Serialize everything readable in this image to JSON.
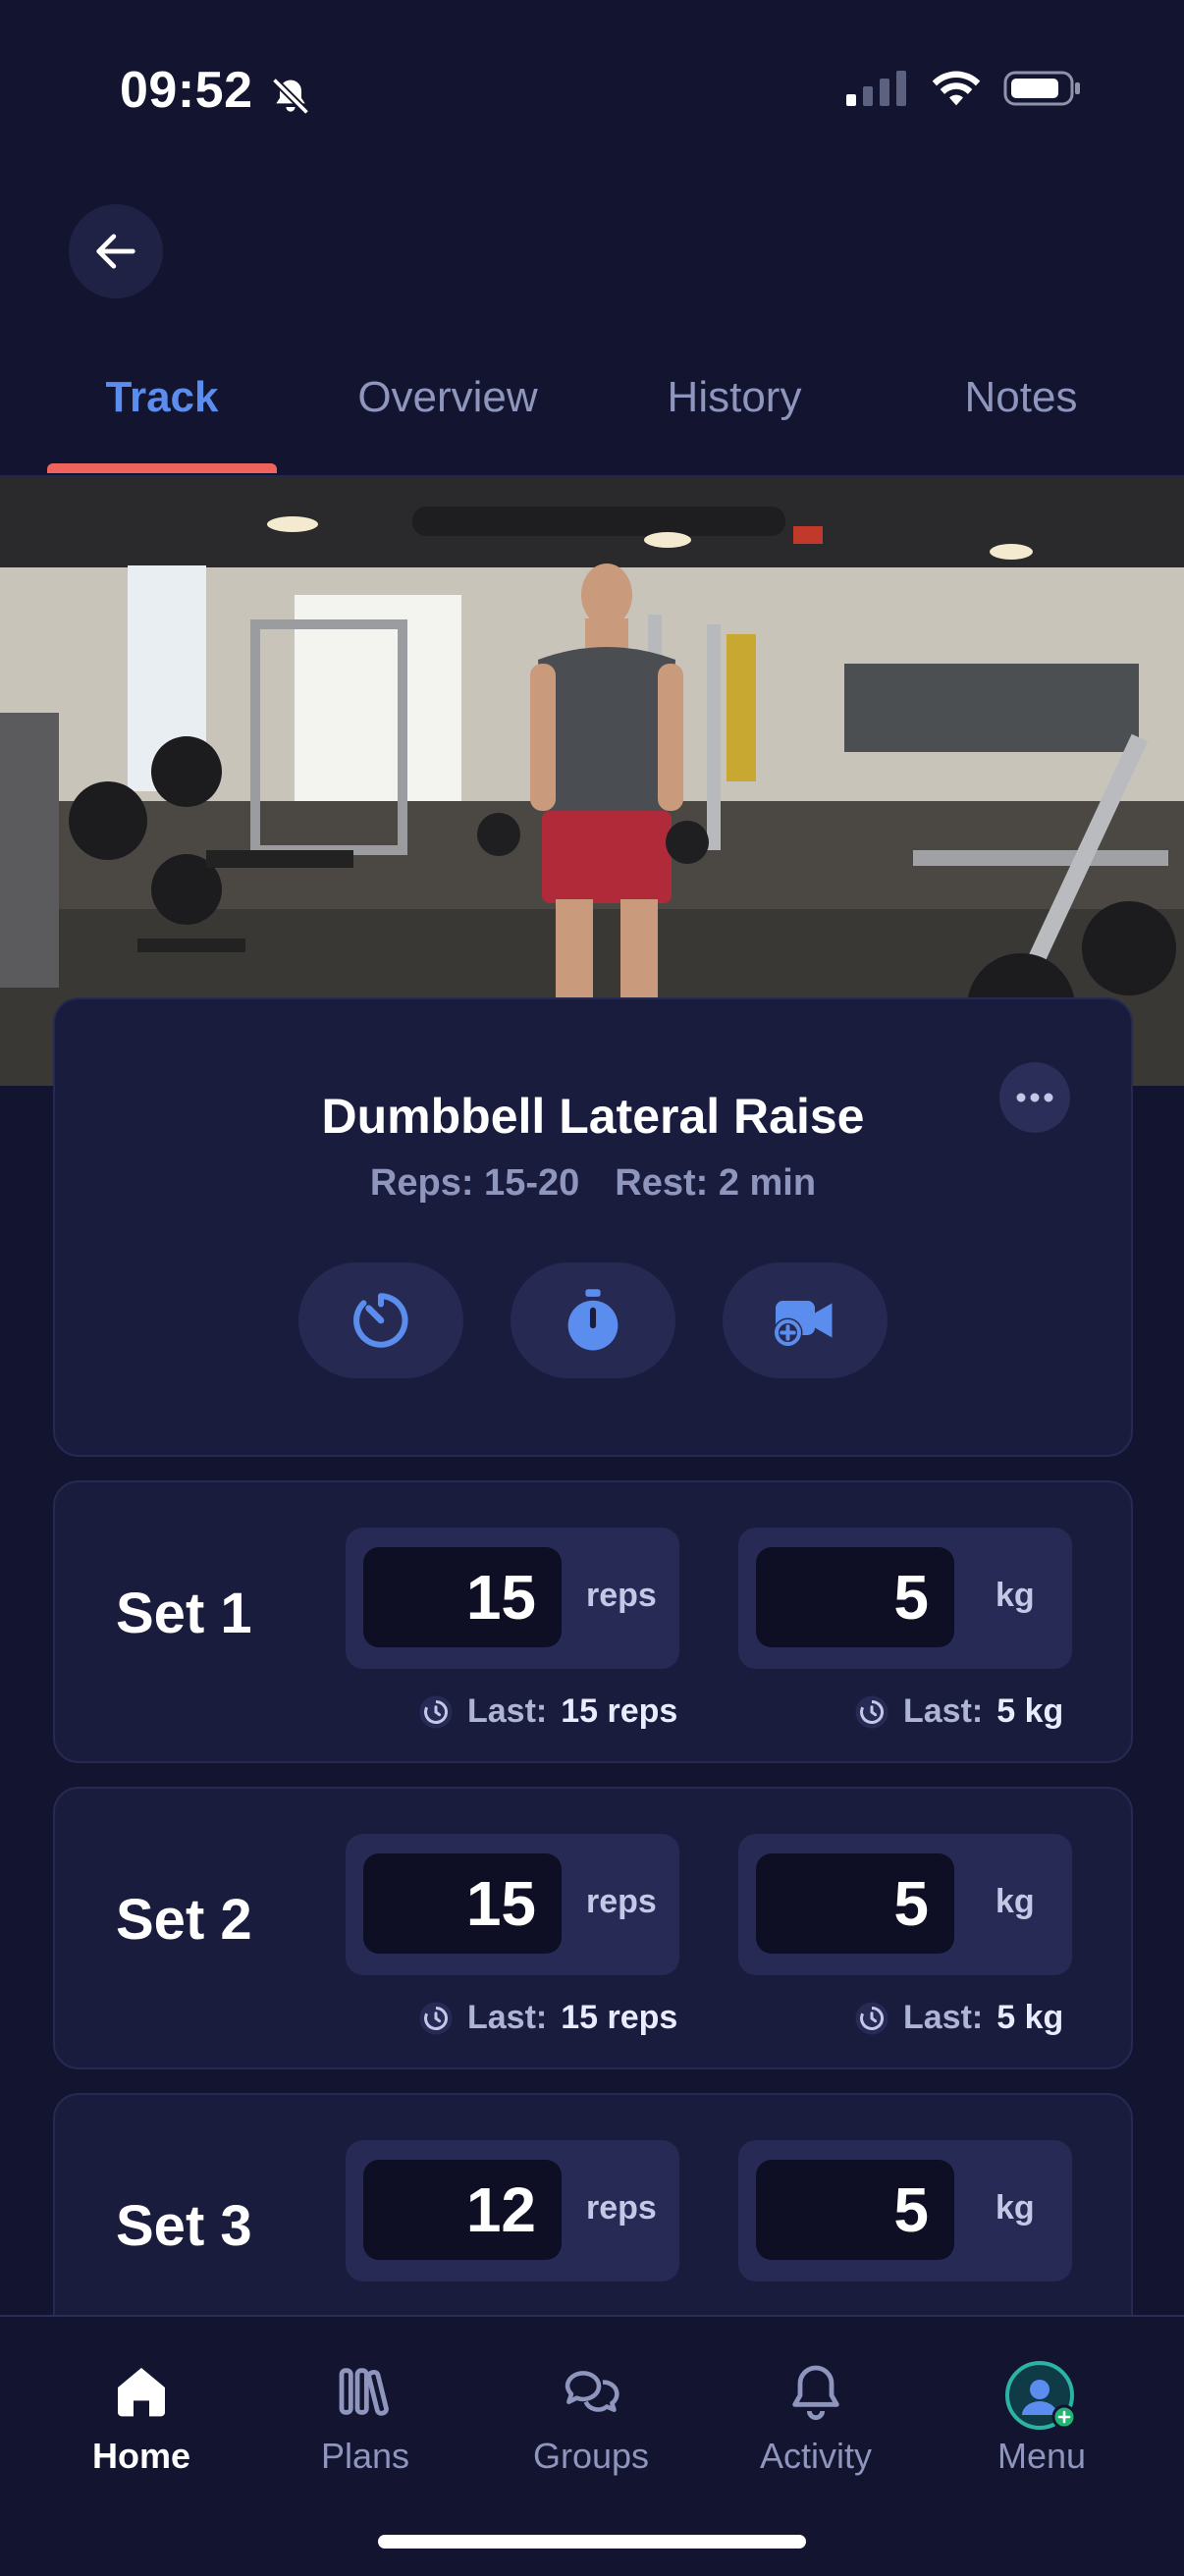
{
  "status_bar": {
    "time": "09:52"
  },
  "tabs": [
    {
      "label": "Track",
      "active": true
    },
    {
      "label": "Overview",
      "active": false
    },
    {
      "label": "History",
      "active": false
    },
    {
      "label": "Notes",
      "active": false
    }
  ],
  "exercise": {
    "title": "Dumbbell Lateral Raise",
    "reps": "Reps: 15-20",
    "rest": "Rest: 2 min"
  },
  "sets": [
    {
      "label": "Set 1",
      "reps": "15",
      "reps_unit": "reps",
      "weight": "5",
      "weight_unit": "kg",
      "last_label": "Last:",
      "last_reps": "15 reps",
      "last_weight": "5 kg"
    },
    {
      "label": "Set 2",
      "reps": "15",
      "reps_unit": "reps",
      "weight": "5",
      "weight_unit": "kg",
      "last_label": "Last:",
      "last_reps": "15 reps",
      "last_weight": "5 kg"
    },
    {
      "label": "Set 3",
      "reps": "12",
      "reps_unit": "reps",
      "weight": "5",
      "weight_unit": "kg"
    }
  ],
  "bottom_nav": [
    {
      "label": "Home",
      "icon": "home-icon",
      "active": true
    },
    {
      "label": "Plans",
      "icon": "plans-icon",
      "active": false
    },
    {
      "label": "Groups",
      "icon": "chat-bubbles-icon",
      "active": false
    },
    {
      "label": "Activity",
      "icon": "bell-icon",
      "active": false
    },
    {
      "label": "Menu",
      "icon": "avatar-icon",
      "active": false
    }
  ],
  "colors": {
    "background": "#13142f",
    "accent": "#5b8def",
    "tab_underline": "#f0625c",
    "card": "#1a1c3d"
  }
}
